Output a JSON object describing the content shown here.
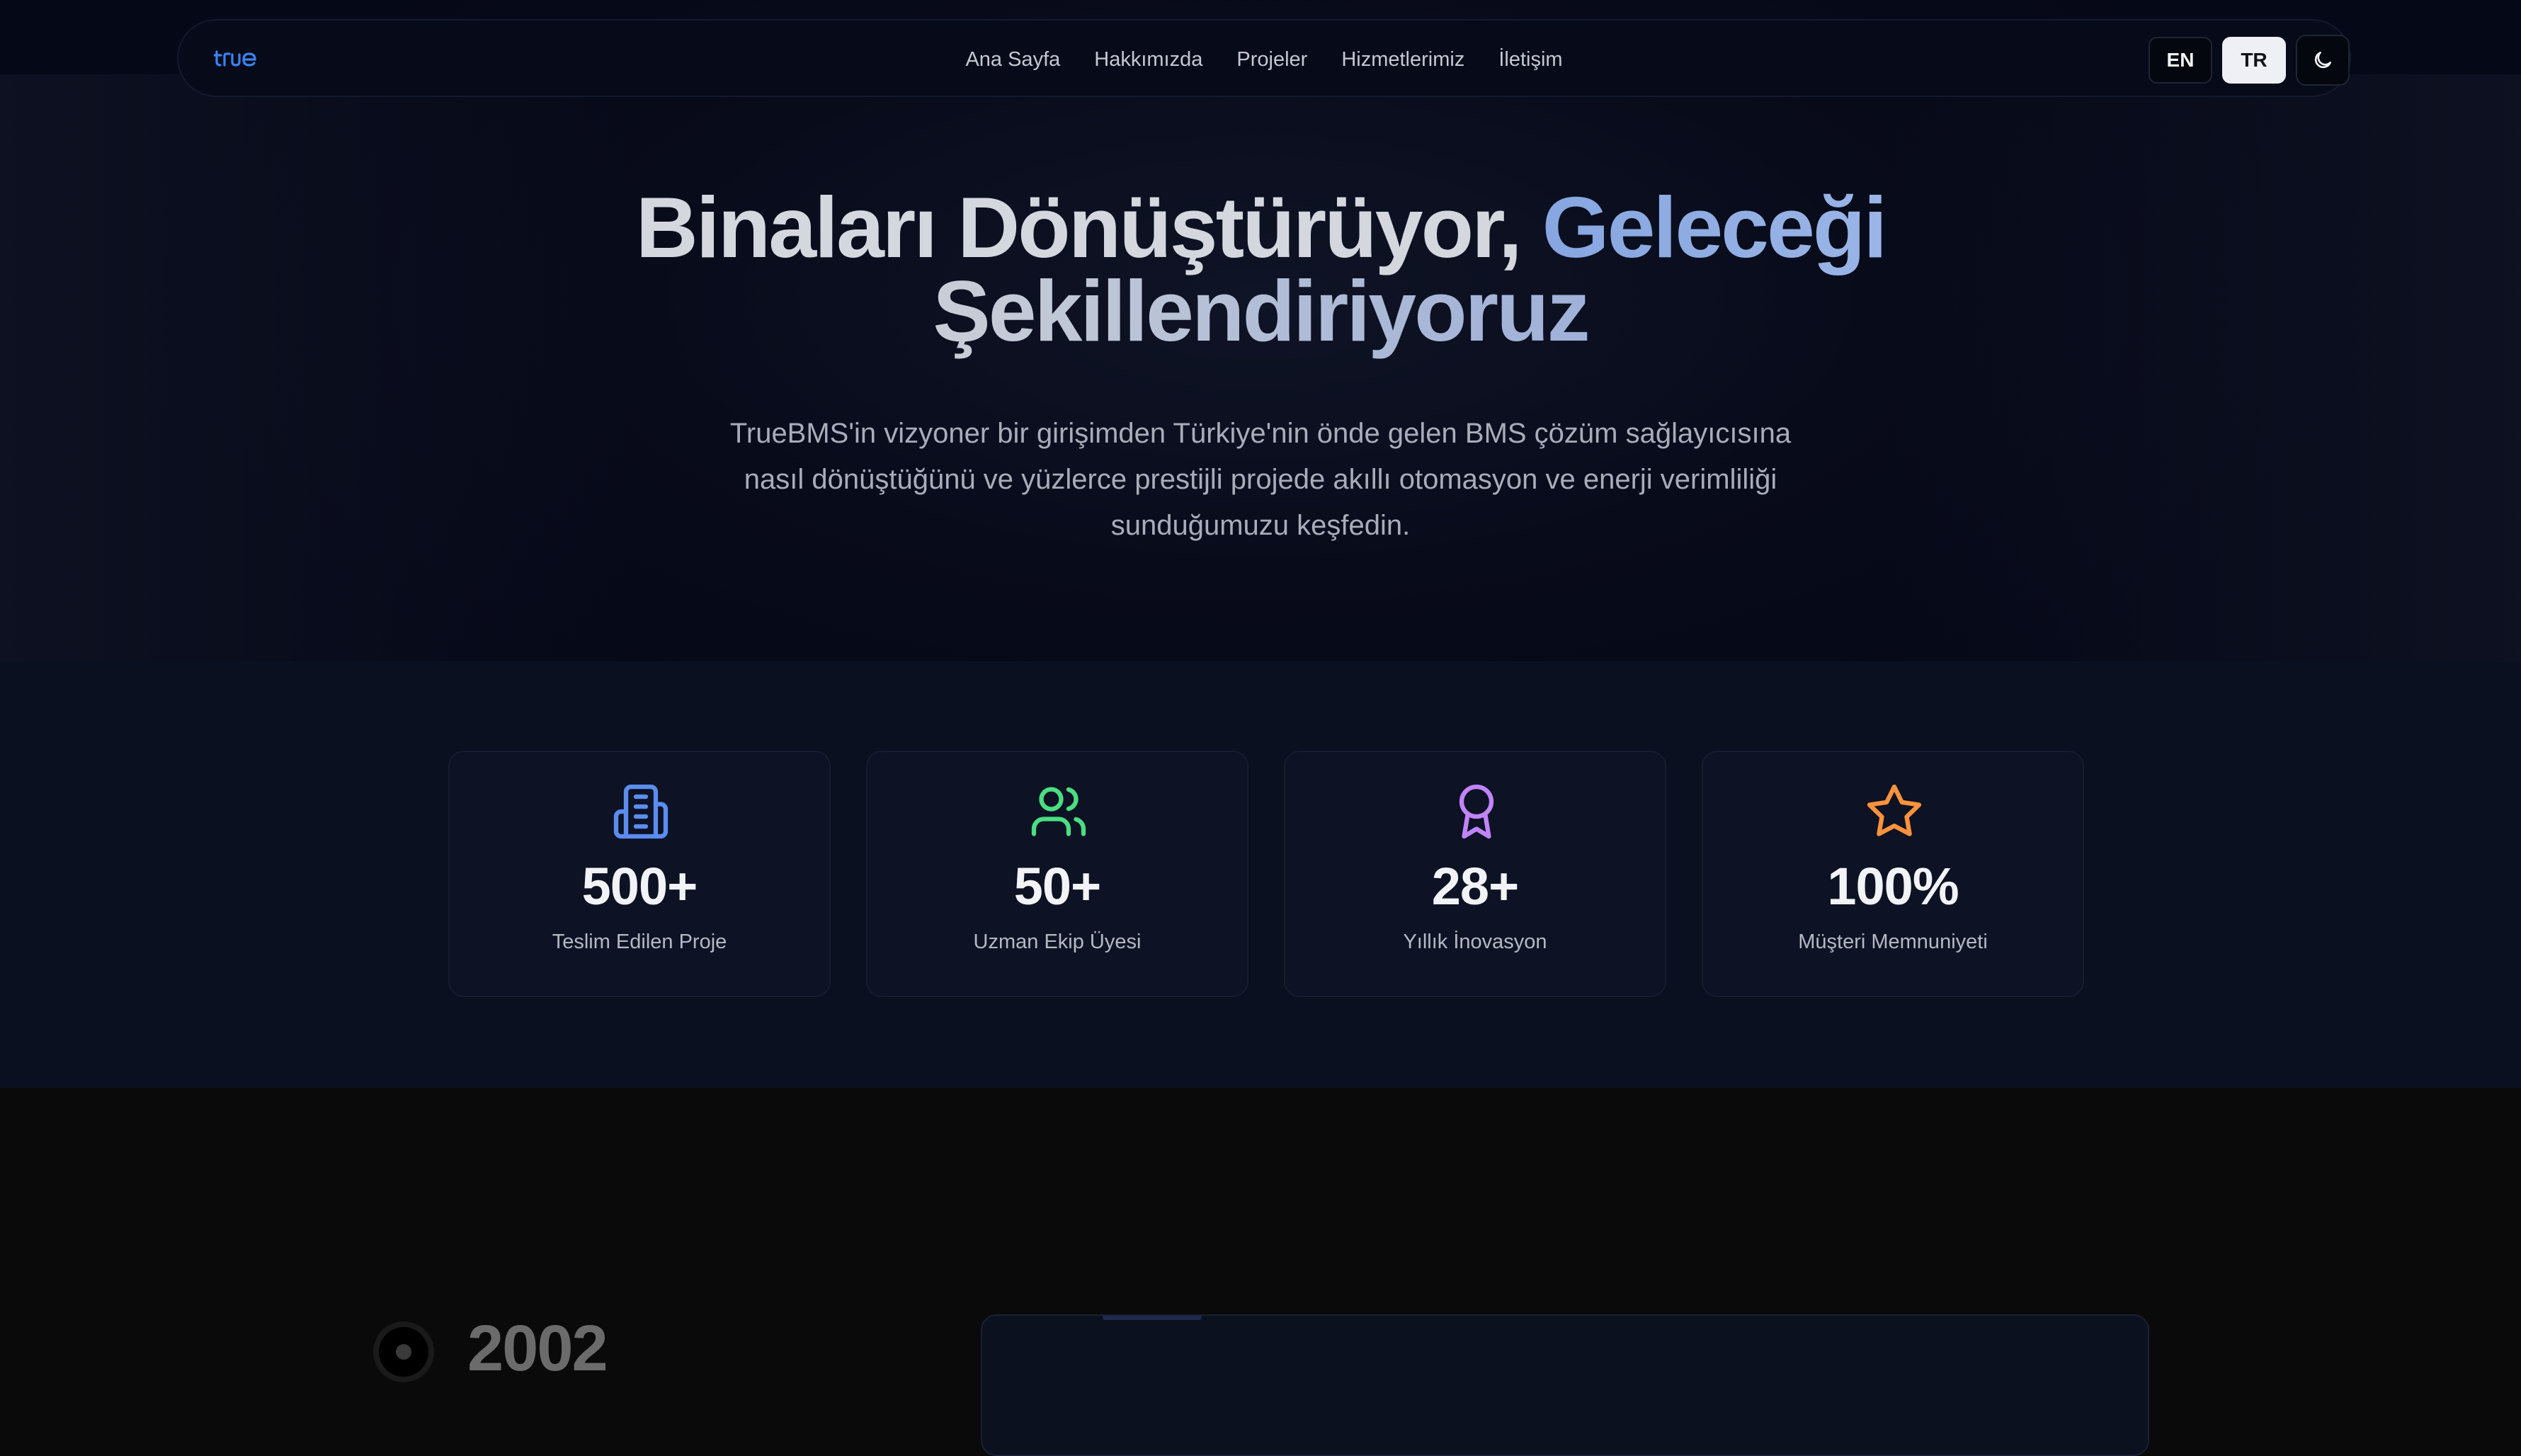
{
  "nav": {
    "logo_text": "true",
    "links": [
      "Ana Sayfa",
      "Hakkımızda",
      "Projeler",
      "Hizmetlerimiz",
      "İletişim"
    ],
    "lang_en": "EN",
    "lang_tr": "TR",
    "active_lang": "TR",
    "theme_icon": "moon-icon"
  },
  "hero": {
    "title_part1": "Binaları Dönüştürüyor, ",
    "title_accent": "Geleceği",
    "title_line2": "Şekillendiriyoruz",
    "subtitle": "TrueBMS'in vizyoner bir girişimden Türkiye'nin önde gelen BMS çözüm sağlayıcısına nasıl dönüştüğünü ve yüzlerce prestijli projede akıllı otomasyon ve enerji verimliliği sunduğumuzu keşfedin."
  },
  "stats": [
    {
      "icon": "building-icon",
      "color": "#5b8def",
      "value": "500+",
      "label": "Teslim Edilen Proje"
    },
    {
      "icon": "users-icon",
      "color": "#4ade80",
      "value": "50+",
      "label": "Uzman Ekip Üyesi"
    },
    {
      "icon": "award-icon",
      "color": "#c084fc",
      "value": "28+",
      "label": "Yıllık İnovasyon"
    },
    {
      "icon": "star-icon",
      "color": "#fb923c",
      "value": "100%",
      "label": "Müşteri Memnuniyeti"
    }
  ],
  "timeline": {
    "first_year": "2002"
  },
  "colors": {
    "background": "#0a0a0a",
    "hero_bg": "#080b1a",
    "stats_bg": "#0b1020",
    "accent_blue": "#87a6e0"
  }
}
